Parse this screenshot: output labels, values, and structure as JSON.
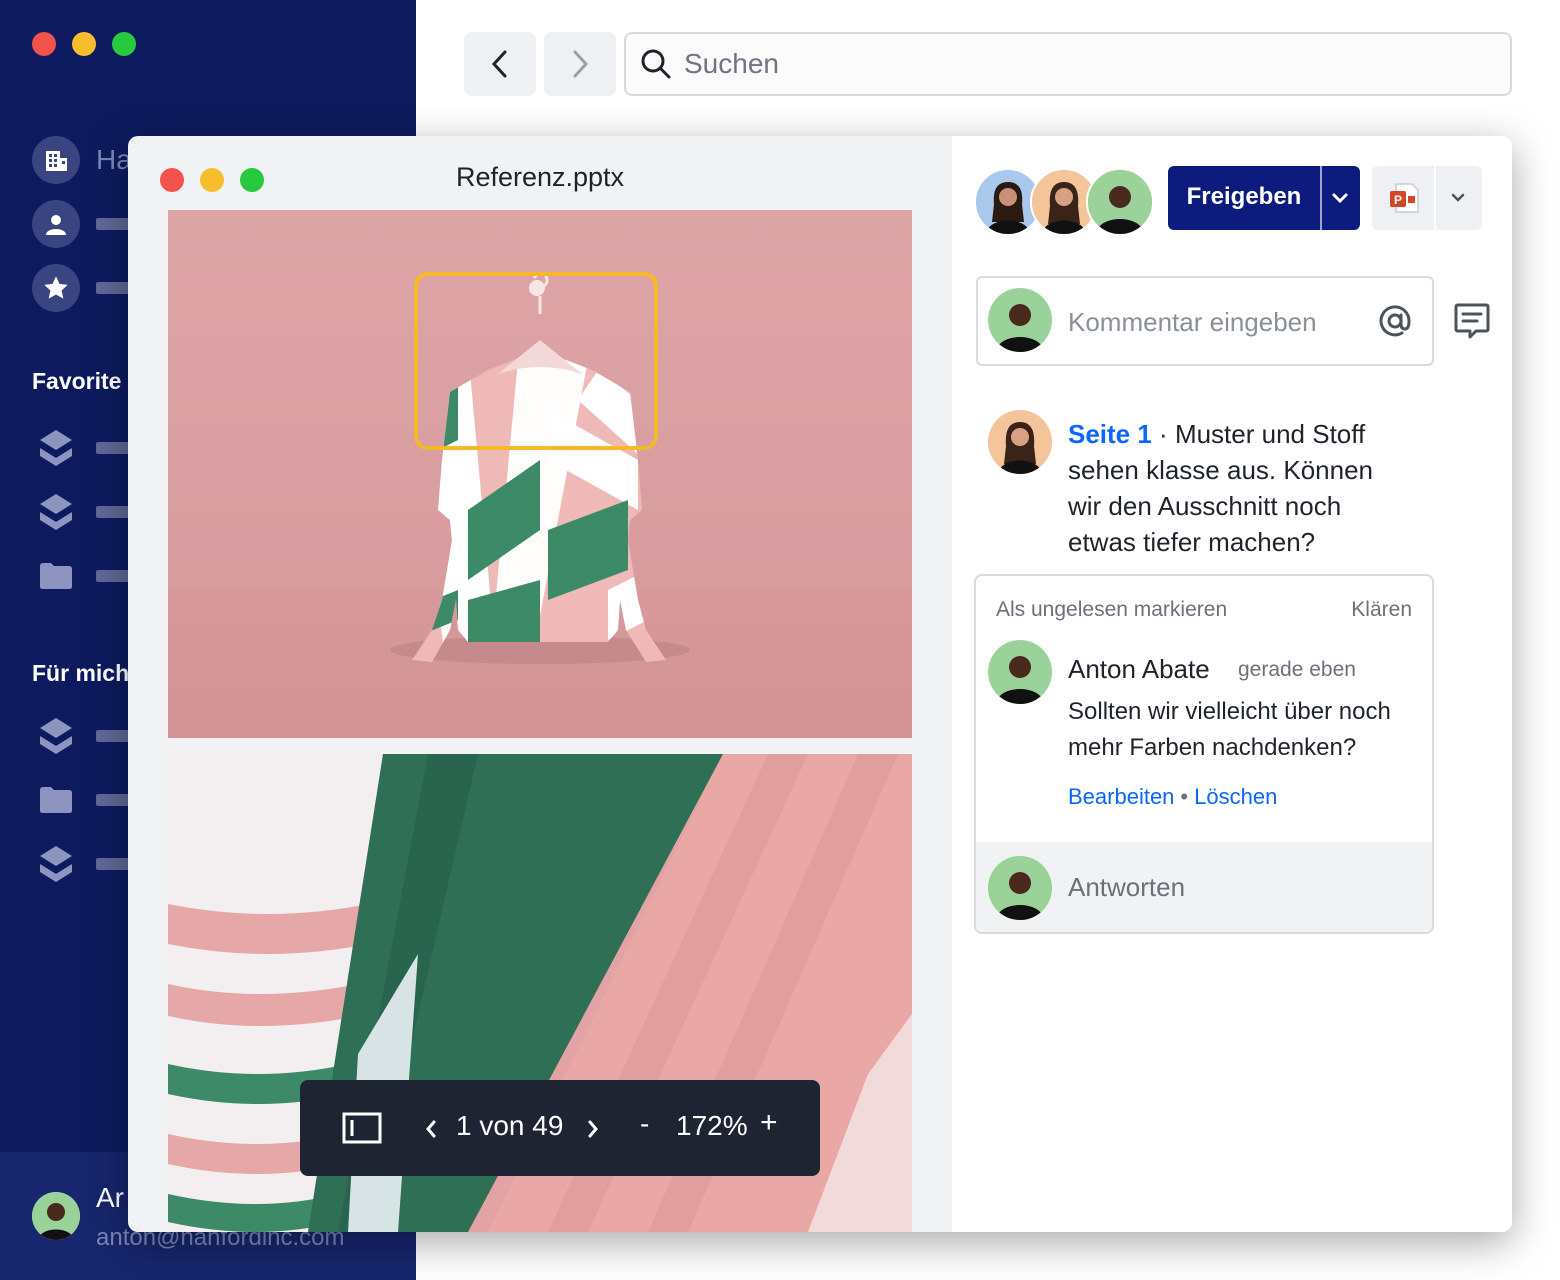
{
  "background_app": {
    "sidebar": {
      "title_partial": "Ha",
      "section_favorites": "Favorite",
      "section_for_me": "Für mich",
      "user_name_partial": "Ar",
      "user_email": "anton@hanfordinc.com"
    },
    "search": {
      "placeholder": "Suchen"
    }
  },
  "viewer": {
    "file_title": "Referenz.pptx",
    "toolbar": {
      "page_indicator": "1 von 49",
      "zoom_level": "172%",
      "zoom_minus": "-",
      "zoom_plus": "+"
    }
  },
  "panel": {
    "share_button": "Freigeben",
    "comment_input": {
      "placeholder": "Kommentar eingeben"
    },
    "pinned_comment": {
      "page_ref": "Seite 1",
      "separator": " · ",
      "text": "Muster und Stoff sehen klasse aus. Können wir den Ausschnitt noch etwas tiefer machen?"
    },
    "thread": {
      "mark_unread": "Als ungelesen markieren",
      "resolve": "Klären",
      "author": "Anton Abate",
      "time": "gerade eben",
      "message": "Sollten wir vielleicht über noch mehr Farben nachdenken?",
      "edit": "Bearbeiten",
      "delete": "Löschen",
      "reply_placeholder": "Antworten"
    }
  },
  "colors": {
    "sidebar_bg": "#0d1b5e",
    "primary_button": "#0d1b7e",
    "link": "#0a66ff",
    "annotation_highlight": "#f7b928"
  }
}
